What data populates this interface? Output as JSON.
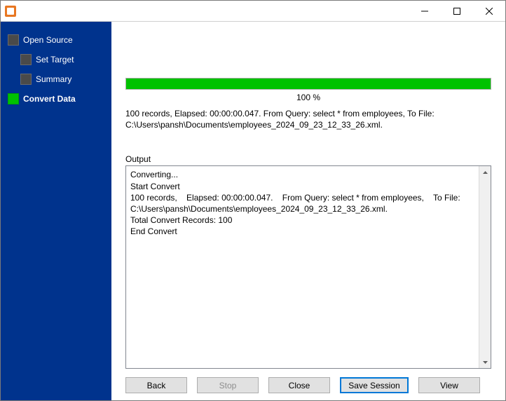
{
  "titlebar": {
    "title": ""
  },
  "sidebar": {
    "items": [
      {
        "label": "Open Source",
        "level": 0,
        "active": false
      },
      {
        "label": "Set Target",
        "level": 1,
        "active": false
      },
      {
        "label": "Summary",
        "level": 1,
        "active": false
      },
      {
        "label": "Convert Data",
        "level": 0,
        "active": true
      }
    ]
  },
  "progress": {
    "percent_label": "100 %"
  },
  "summary_text": "100 records,    Elapsed: 00:00:00.047.    From Query: select * from employees,    To File: C:\\Users\\pansh\\Documents\\employees_2024_09_23_12_33_26.xml.",
  "output": {
    "label": "Output",
    "text": "Converting...\nStart Convert\n100 records,    Elapsed: 00:00:00.047.    From Query: select * from employees,    To File: C:\\Users\\pansh\\Documents\\employees_2024_09_23_12_33_26.xml.\nTotal Convert Records: 100\nEnd Convert"
  },
  "buttons": {
    "back": "Back",
    "stop": "Stop",
    "close": "Close",
    "save": "Save Session",
    "view": "View"
  }
}
